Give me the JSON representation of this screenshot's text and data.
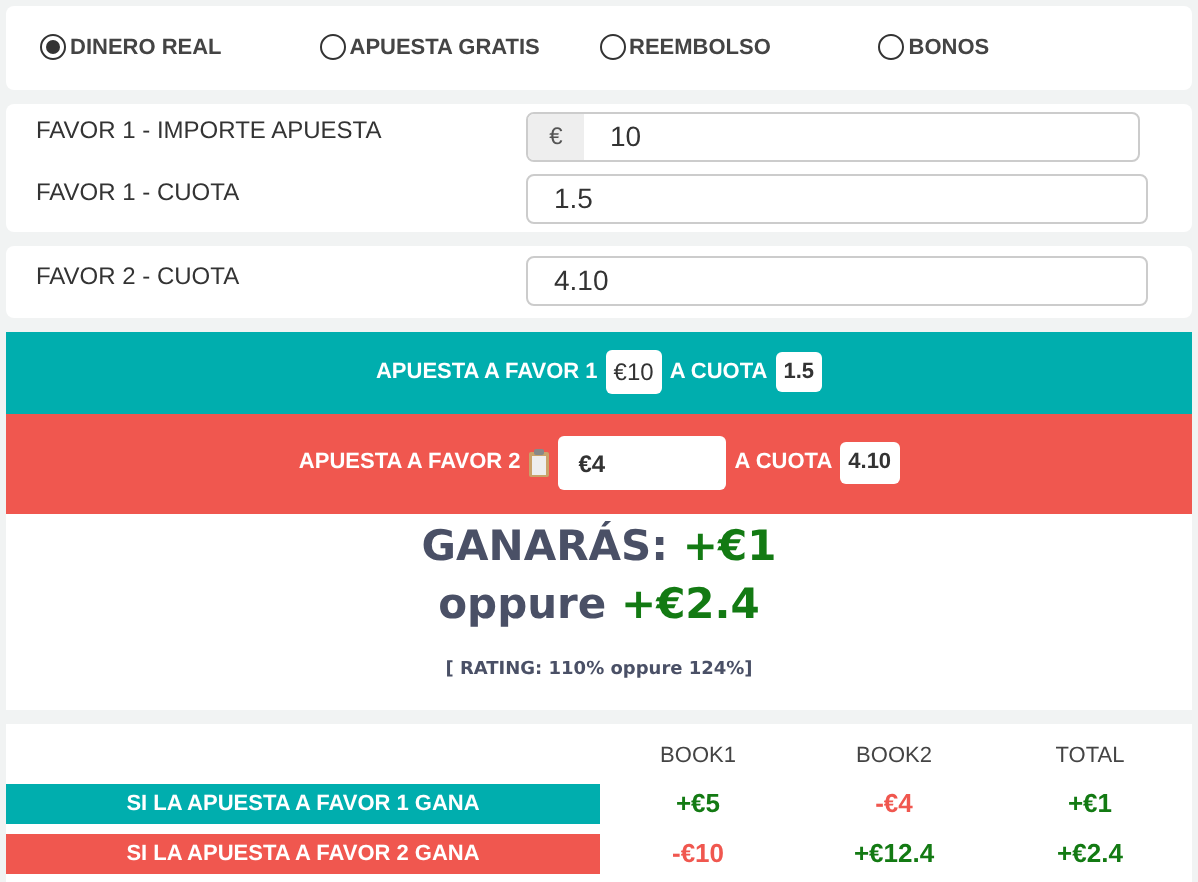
{
  "bet_types": [
    {
      "label": "DINERO REAL",
      "selected": true
    },
    {
      "label": "APUESTA GRATIS",
      "selected": false
    },
    {
      "label": "REEMBOLSO",
      "selected": false
    },
    {
      "label": "BONOS",
      "selected": false
    }
  ],
  "favor1": {
    "amount_label": "FAVOR 1 - IMPORTE APUESTA",
    "currency": "€",
    "amount": "10",
    "odds_label": "FAVOR 1 - CUOTA",
    "odds": "1.5"
  },
  "favor2": {
    "odds_label": "FAVOR 2 - CUOTA",
    "odds": "4.10"
  },
  "bet1": {
    "label": "APUESTA A FAVOR 1",
    "amount": "€10",
    "odds_label": "A CUOTA",
    "odds": "1.5"
  },
  "bet2": {
    "label": "APUESTA A FAVOR 2",
    "amount": "€4",
    "odds_label": "A CUOTA",
    "odds": "4.10"
  },
  "result": {
    "win_label": "GANARÁS:",
    "win": "+€1",
    "or_label": "oppure",
    "or_value": "+€2.4",
    "rating": "[ RATING: 110% oppure 124%]"
  },
  "table": {
    "columns": [
      "BOOK1",
      "BOOK2",
      "TOTAL"
    ],
    "rows": [
      {
        "label": "SI LA APUESTA A FAVOR 1 GANA",
        "color": "#00aeae",
        "cells": [
          {
            "text": "+€5",
            "kind": "gain"
          },
          {
            "text": "-€4",
            "kind": "loss"
          },
          {
            "text": "+€1",
            "kind": "gain"
          }
        ]
      },
      {
        "label": "SI LA APUESTA A FAVOR 2 GANA",
        "color": "#f0574f",
        "cells": [
          {
            "text": "-€10",
            "kind": "loss"
          },
          {
            "text": "+€12.4",
            "kind": "gain"
          },
          {
            "text": "+€2.4",
            "kind": "gain"
          }
        ]
      }
    ]
  }
}
